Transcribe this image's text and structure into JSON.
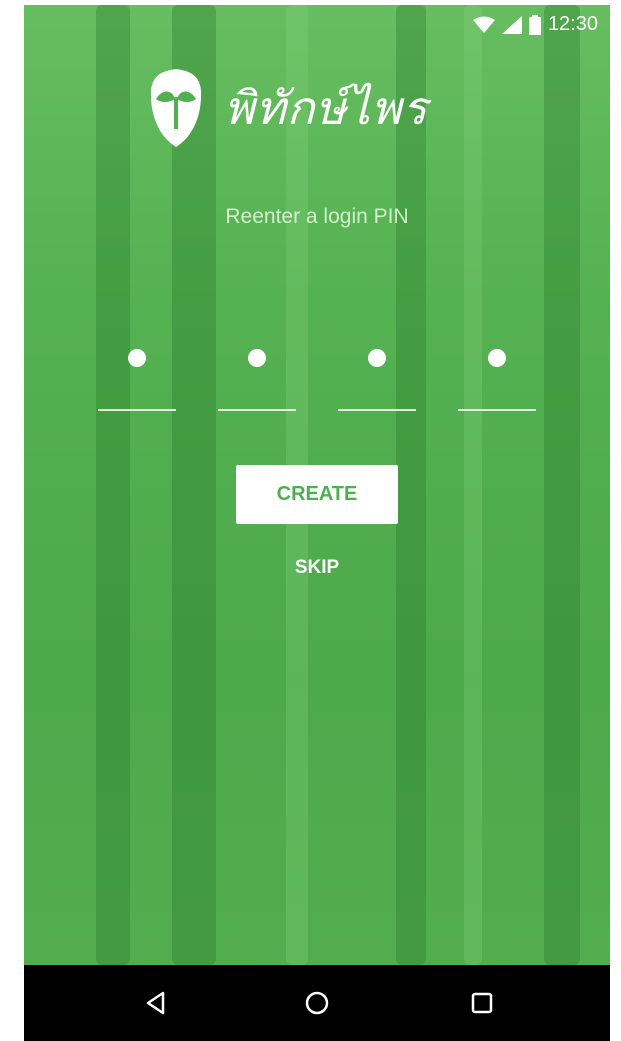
{
  "status_bar": {
    "time": "12:30",
    "icons": [
      "wifi-icon",
      "signal-icon",
      "battery-icon"
    ]
  },
  "logo": {
    "text": "พิทักษ์ไพร",
    "icon": "shield-leaf-icon"
  },
  "prompt": "Reenter a login PIN",
  "pin": {
    "length": 4,
    "filled": 4,
    "dot_icon": "pin-dot"
  },
  "actions": {
    "create_label": "CREATE",
    "skip_label": "SKIP"
  },
  "nav_bar": {
    "buttons": [
      "back-icon",
      "home-icon",
      "recents-icon"
    ]
  },
  "colors": {
    "primary_green": "#4caf50",
    "background_green": "#52b04f",
    "nav_bar": "#000000",
    "white": "#ffffff"
  }
}
